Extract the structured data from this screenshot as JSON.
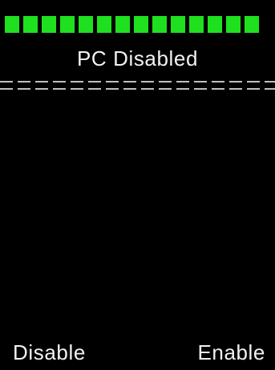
{
  "status_bar": {
    "segment_count": 14,
    "color": "#1fe01f"
  },
  "title": "PC Disabled",
  "softkeys": {
    "left_label": "Disable",
    "right_label": "Enable"
  },
  "colors": {
    "background": "#000000",
    "text": "#f2f2f2",
    "divider": "#bfbfbf"
  }
}
